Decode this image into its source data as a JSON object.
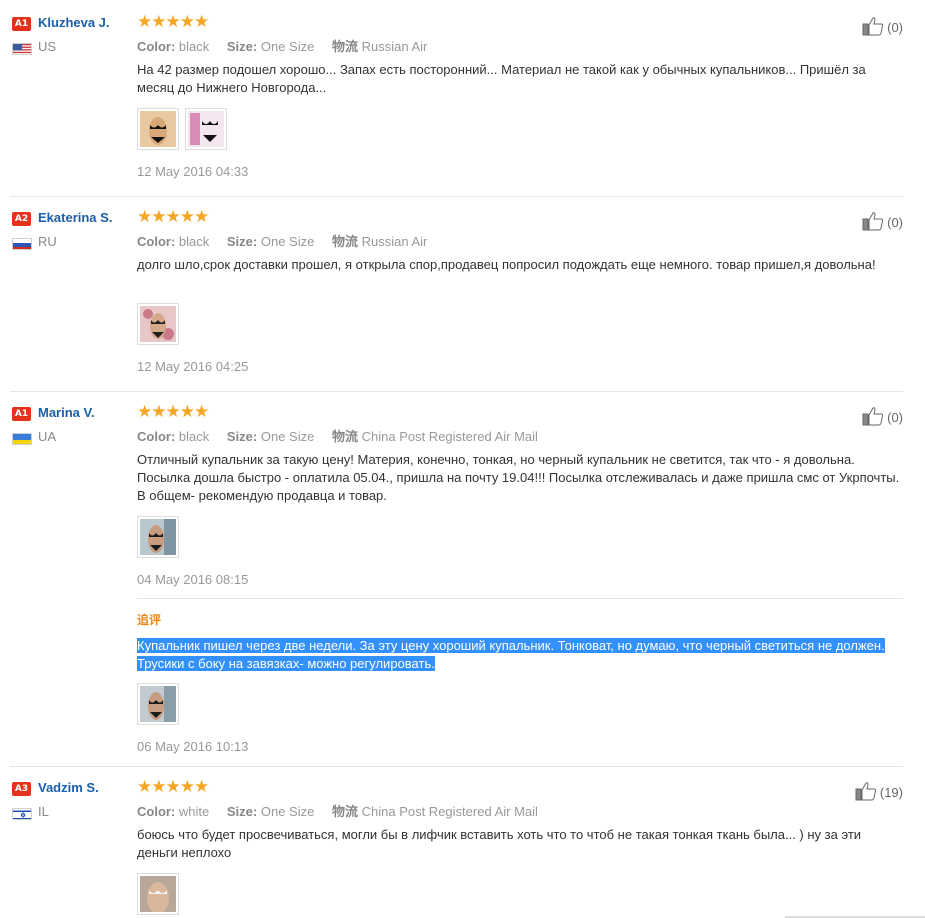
{
  "reviews": [
    {
      "badge": "A1",
      "name": "Kluzheva J.",
      "country": "US",
      "stars": "★★★★★",
      "color_label": "Color:",
      "color": "black",
      "size_label": "Size:",
      "size": "One Size",
      "ship_label": "物流",
      "ship": "Russian Air",
      "text": "На 42 размер подошел хорошо... Запах есть посторонний... Материал не такой как у обычных купальников... Пришёл за месяц до Нижнего Новгорода...",
      "date": "12 May 2016 04:33",
      "likes": "(0)"
    },
    {
      "badge": "A2",
      "name": "Ekaterina S.",
      "country": "RU",
      "stars": "★★★★★",
      "color_label": "Color:",
      "color": "black",
      "size_label": "Size:",
      "size": "One Size",
      "ship_label": "物流",
      "ship": "Russian Air",
      "text": "долго шло,срок доставки прошел, я открыла спор,продавец попросил подождать еще немного. товар пришел,я довольна!",
      "date": "12 May 2016 04:25",
      "likes": "(0)"
    },
    {
      "badge": "A1",
      "name": "Marina V.",
      "country": "UA",
      "stars": "★★★★★",
      "color_label": "Color:",
      "color": "black",
      "size_label": "Size:",
      "size": "One Size",
      "ship_label": "物流",
      "ship": "China Post Registered Air Mail",
      "text": "Отличный купальник за такую цену! Материя, конечно, тонкая, но черный купальник не светится, так что - я довольна. Посылка дошла быстро - оплатила 05.04., пришла на почту 19.04!!! Посылка отслеживалась и даже пришла смс от Укрпочты. В общем- рекомендую продавца и товар.",
      "date": "04 May 2016 08:15",
      "likes": "(0)",
      "additional_label": "追评",
      "additional_text": "Купальник пишел через две недели. За эту цену хороший купальник. Тонковат, но думаю, что черный светиться не должен. Трусики с боку на завязках- можно регулировать.",
      "additional_date": "06 May 2016 10:13"
    },
    {
      "badge": "A3",
      "name": "Vadzim S.",
      "country": "IL",
      "stars": "★★★★★",
      "color_label": "Color:",
      "color": "white",
      "size_label": "Size:",
      "size": "One Size",
      "ship_label": "物流",
      "ship": "China Post Registered Air Mail",
      "text": "боюсь что будет просвечиваться, могли бы в лифчик вставить хоть что то чтоб не такая тонкая ткань была... ) ну за эти деньги неплохо",
      "likes": "(19)"
    }
  ],
  "colors": {
    "link": "#1a5faa",
    "star": "#f5a623",
    "badge": "#e4331a",
    "selection": "#3390ff",
    "additional_label": "#e08b1e"
  },
  "icons": {
    "thumbs_up": "thumbs-up-icon",
    "star": "star-icon"
  }
}
